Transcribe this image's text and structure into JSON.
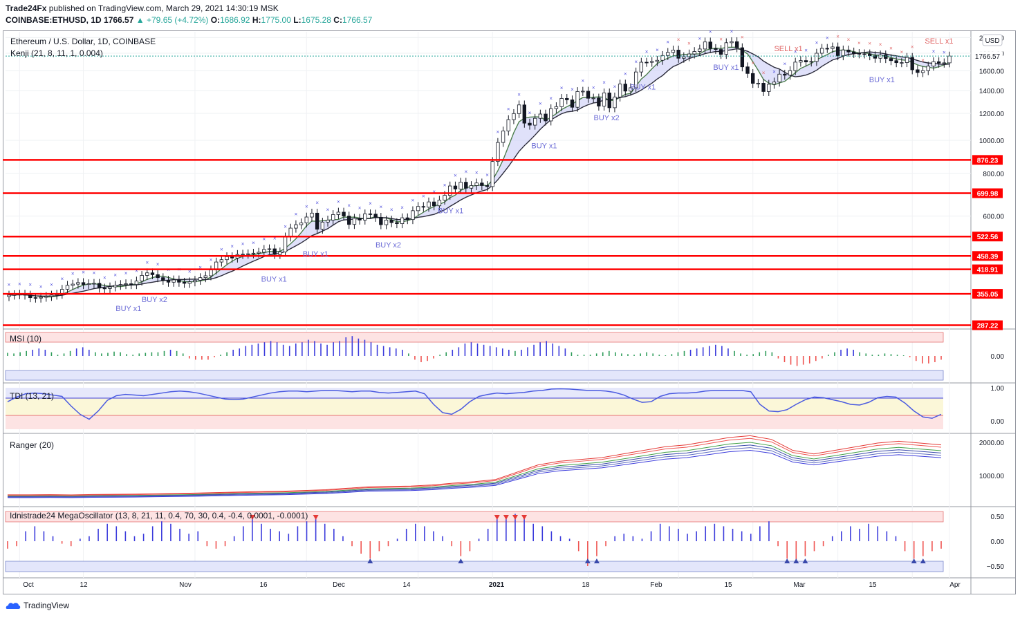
{
  "header": {
    "publisher": "Trade24Fx",
    "published_text": " published on TradingView.com, March 29, 2021 14:30:19 MSK",
    "symbol": "COINBASE:ETHUSD, 1D",
    "last": "1766.57",
    "change": "+79.65 (+4.72%)",
    "open_label": "O:",
    "open": "1686.92",
    "high_label": "H:",
    "high": "1775.00",
    "low_label": "L:",
    "low": "1675.28",
    "close_label": "C:",
    "close": "1766.57"
  },
  "main_pane": {
    "title": "Ethereum / U.S. Dollar, 1D, COINBASE",
    "indicator": "Kenji (21, 8, 11, 1, 0.004)",
    "currency": "USD",
    "price_tag": "1766.57"
  },
  "panes": {
    "msi": {
      "title": "MSI (10)",
      "ticks": [
        "0.00"
      ]
    },
    "tdi": {
      "title": "TDI (13, 21)",
      "ticks": [
        "1.00",
        "0.00"
      ]
    },
    "ranger": {
      "title": "Ranger (20)",
      "ticks": [
        "2000.00",
        "1000.00"
      ]
    },
    "mega": {
      "title": "Idnistrade24 MegaOscillator (13, 8, 21, 11, 0.4, 70, 30, 0.4, -0.4, 0.0001, -0.0001)",
      "ticks": [
        "0.50",
        "0.00",
        "−0.50"
      ]
    }
  },
  "x_axis": [
    "Oct",
    "12",
    "Nov",
    "16",
    "Dec",
    "14",
    "2021",
    "18",
    "Feb",
    "15",
    "Mar",
    "15",
    "Apr"
  ],
  "footer": {
    "brand": "TradingView"
  },
  "colors": {
    "up": "#26a69a",
    "down": "#ef5350",
    "level": "#ff0000",
    "blue": "#3c3cdc",
    "signal_buy": "#6b6bd6",
    "signal_sell": "#e06666"
  },
  "chart_data": [
    {
      "type": "candlestick",
      "title": "Ethereum / U.S. Dollar, 1D, COINBASE",
      "ylabel": "USD",
      "ylim": [
        280,
        2080
      ],
      "y_ticks": [
        600,
        800,
        1000,
        1200,
        1400,
        1600,
        1800,
        2000
      ],
      "x_dates_range": [
        "2020-09-29",
        "2021-03-29"
      ],
      "close_series": [
        352,
        353,
        354,
        352,
        346,
        345,
        347,
        349,
        352,
        354,
        366,
        376,
        379,
        383,
        378,
        380,
        381,
        369,
        368,
        372,
        376,
        378,
        380,
        378,
        387,
        402,
        409,
        404,
        396,
        389,
        384,
        390,
        384,
        381,
        385,
        389,
        396,
        401,
        417,
        440,
        447,
        456,
        452,
        463,
        464,
        465,
        467,
        470,
        479,
        481,
        463,
        471,
        521,
        553,
        566,
        573,
        596,
        612,
        549,
        576,
        584,
        606,
        616,
        600,
        567,
        591,
        584,
        609,
        608,
        595,
        566,
        584,
        574,
        570,
        593,
        586,
        622,
        640,
        637,
        660,
        643,
        668,
        690,
        735,
        720,
        754,
        724,
        737,
        750,
        737,
        732,
        867,
        986,
        1065,
        1150,
        1198,
        1270,
        1123,
        1108,
        1160,
        1194,
        1140,
        1238,
        1255,
        1327,
        1314,
        1250,
        1390,
        1393,
        1328,
        1330,
        1260,
        1377,
        1246,
        1340,
        1462,
        1394,
        1426,
        1586,
        1694,
        1693,
        1703,
        1716,
        1773,
        1810,
        1839,
        1740,
        1758,
        1791,
        1821,
        1852,
        1942,
        1858,
        1846,
        1786,
        1932,
        1946,
        1868,
        1642,
        1570,
        1469,
        1470,
        1390,
        1460,
        1482,
        1563,
        1552,
        1600,
        1695,
        1713,
        1697,
        1703,
        1800,
        1860,
        1858,
        1878,
        1770,
        1840,
        1815,
        1797,
        1793,
        1792,
        1770,
        1740,
        1780,
        1737,
        1712,
        1689,
        1690,
        1750,
        1610,
        1580,
        1600,
        1650,
        1700,
        1684,
        1687,
        1766
      ],
      "levels": [
        876.23,
        699.98,
        522.56,
        458.39,
        418.91,
        355.05,
        287.22
      ],
      "lines": [
        "Kenji fast line",
        "Kenji slow line"
      ],
      "signals": [
        {
          "label": "BUY x1",
          "x": "2020-10-22"
        },
        {
          "label": "BUY x2",
          "x": "2020-10-27"
        },
        {
          "label": "BUY x1",
          "x": "2020-11-19"
        },
        {
          "label": "BUY x1",
          "x": "2020-11-27"
        },
        {
          "label": "BUY x2",
          "x": "2020-12-11"
        },
        {
          "label": "BUY x1",
          "x": "2020-12-23"
        },
        {
          "label": "BUY x1",
          "x": "2021-01-10"
        },
        {
          "label": "BUY x2",
          "x": "2021-01-22"
        },
        {
          "label": "BUY x1",
          "x": "2021-01-29"
        },
        {
          "label": "BUY x1",
          "x": "2021-02-14"
        },
        {
          "label": "SELL x1",
          "x": "2021-02-26"
        },
        {
          "label": "BUY x1",
          "x": "2021-03-16"
        },
        {
          "label": "SELL x1",
          "x": "2021-03-27"
        }
      ]
    },
    {
      "type": "bar",
      "title": "MSI (10)",
      "ylim": [
        -0.4,
        0.4
      ],
      "values": [
        0.05,
        0.04,
        0.06,
        0.08,
        0.1,
        0.12,
        0.1,
        0.06,
        0.02,
        0.04,
        0.08,
        0.12,
        0.14,
        0.1,
        0.06,
        0.04,
        0.05,
        0.07,
        0.06,
        0.03,
        0.02,
        0.04,
        0.05,
        0.06,
        0.06,
        0.08,
        0.1,
        0.08,
        0.04,
        -0.04,
        -0.06,
        -0.06,
        -0.06,
        -0.02,
        0.02,
        0.06,
        0.1,
        0.12,
        0.16,
        0.18,
        0.2,
        0.22,
        0.24,
        0.22,
        0.18,
        0.16,
        0.2,
        0.22,
        0.26,
        0.24,
        0.2,
        0.18,
        0.22,
        0.24,
        0.3,
        0.32,
        0.28,
        0.26,
        0.22,
        0.18,
        0.16,
        0.14,
        0.12,
        0.1,
        0.04,
        -0.06,
        -0.1,
        -0.08,
        -0.04,
        0.02,
        0.06,
        0.1,
        0.14,
        0.2,
        0.22,
        0.2,
        0.18,
        0.16,
        0.14,
        0.12,
        0.1,
        0.08,
        0.1,
        0.14,
        0.18,
        0.22,
        0.24,
        0.2,
        0.16,
        0.12,
        0.06,
        0.02,
        0.02,
        0.02,
        0.04,
        0.06,
        0.08,
        0.06,
        0.04,
        0.03,
        0.02,
        0.04,
        0.06,
        0.04,
        0.02,
        0.01,
        0.03,
        0.06,
        0.08,
        0.1,
        0.12,
        0.14,
        0.16,
        0.18,
        0.16,
        0.12,
        0.08,
        0.04,
        0.02,
        0.03,
        0.06,
        0.08,
        0.06,
        -0.04,
        -0.1,
        -0.14,
        -0.16,
        -0.14,
        -0.12,
        -0.08,
        -0.04,
        0.02,
        0.06,
        0.1,
        0.12,
        0.1,
        0.06,
        0.04,
        0.02,
        0.02,
        0.04,
        0.03,
        0.02,
        0.01,
        -0.02,
        -0.08,
        -0.12,
        -0.12,
        -0.1,
        -0.06
      ]
    },
    {
      "type": "line",
      "title": "TDI (13, 21)",
      "ylim": [
        -0.2,
        1.2
      ],
      "values": [
        0.58,
        0.72,
        0.82,
        0.84,
        0.82,
        0.78,
        0.74,
        0.45,
        0.2,
        0.05,
        0.3,
        0.62,
        0.76,
        0.8,
        0.78,
        0.76,
        0.8,
        0.84,
        0.88,
        0.9,
        0.88,
        0.84,
        0.78,
        0.72,
        0.66,
        0.64,
        0.66,
        0.72,
        0.78,
        0.84,
        0.88,
        0.9,
        0.9,
        0.88,
        0.9,
        0.92,
        0.92,
        0.9,
        0.88,
        0.9,
        0.9,
        0.86,
        0.84,
        0.86,
        0.88,
        0.9,
        0.82,
        0.5,
        0.25,
        0.2,
        0.35,
        0.58,
        0.74,
        0.8,
        0.84,
        0.82,
        0.84,
        0.86,
        0.9,
        0.92,
        0.96,
        0.97,
        0.96,
        0.94,
        0.92,
        0.92,
        0.9,
        0.86,
        0.78,
        0.66,
        0.56,
        0.58,
        0.74,
        0.82,
        0.84,
        0.84,
        0.86,
        0.9,
        0.92,
        0.92,
        0.92,
        0.92,
        0.88,
        0.5,
        0.3,
        0.28,
        0.34,
        0.5,
        0.64,
        0.72,
        0.7,
        0.64,
        0.58,
        0.5,
        0.48,
        0.56,
        0.7,
        0.74,
        0.72,
        0.54,
        0.3,
        0.12,
        0.08,
        0.2
      ]
    },
    {
      "type": "line",
      "title": "Ranger (20)",
      "ylim": [
        0,
        2300
      ],
      "series": [
        {
          "name": "",
          "values": [
            380,
            380,
            385,
            378,
            390,
            395,
            400,
            410,
            420,
            430,
            445,
            460,
            470,
            480,
            500,
            520,
            560,
            600,
            610,
            620,
            650,
            700,
            740,
            800,
            1000,
            1200,
            1300,
            1350,
            1400,
            1500,
            1600,
            1700,
            1750,
            1850,
            1950,
            2000,
            1900,
            1600,
            1500,
            1600,
            1700,
            1800,
            1850,
            1800,
            1750
          ]
        }
      ]
    },
    {
      "type": "bar",
      "title": "Idnistrade24 MegaOscillator (13, 8, 21, 11, 0.4, 70, 30, 0.4, -0.4, 0.0001, -0.0001)",
      "ylim": [
        -0.7,
        0.7
      ],
      "values": [
        -0.15,
        -0.1,
        0.2,
        0.3,
        0.2,
        0.1,
        -0.05,
        -0.1,
        0.05,
        0.1,
        0.25,
        0.35,
        0.3,
        0.2,
        0.1,
        0.15,
        0.3,
        0.4,
        0.35,
        0.25,
        0.15,
        0.2,
        -0.1,
        -0.15,
        -0.1,
        0.1,
        0.3,
        0.45,
        0.35,
        0.25,
        0.2,
        0.15,
        0.3,
        0.4,
        0.5,
        0.35,
        0.25,
        0.1,
        -0.1,
        -0.25,
        -0.35,
        -0.2,
        -0.1,
        0.05,
        0.25,
        0.35,
        0.3,
        0.2,
        0.1,
        -0.1,
        -0.3,
        -0.2,
        0.05,
        0.25,
        0.45,
        0.5,
        0.55,
        0.45,
        0.35,
        0.3,
        0.2,
        0.1,
        0.05,
        -0.2,
        -0.5,
        -0.3,
        -0.1,
        0.1,
        0.15,
        0.1,
        0.05,
        0.2,
        0.35,
        0.3,
        0.25,
        0.15,
        0.2,
        0.3,
        0.35,
        0.3,
        0.25,
        0.2,
        0.15,
        0.3,
        0.4,
        -0.1,
        -0.35,
        -0.4,
        -0.3,
        -0.2,
        -0.1,
        0.1,
        0.2,
        0.3,
        0.25,
        0.35,
        0.3,
        0.2,
        0.1,
        -0.2,
        -0.35,
        -0.3,
        -0.2,
        -0.15
      ]
    }
  ]
}
